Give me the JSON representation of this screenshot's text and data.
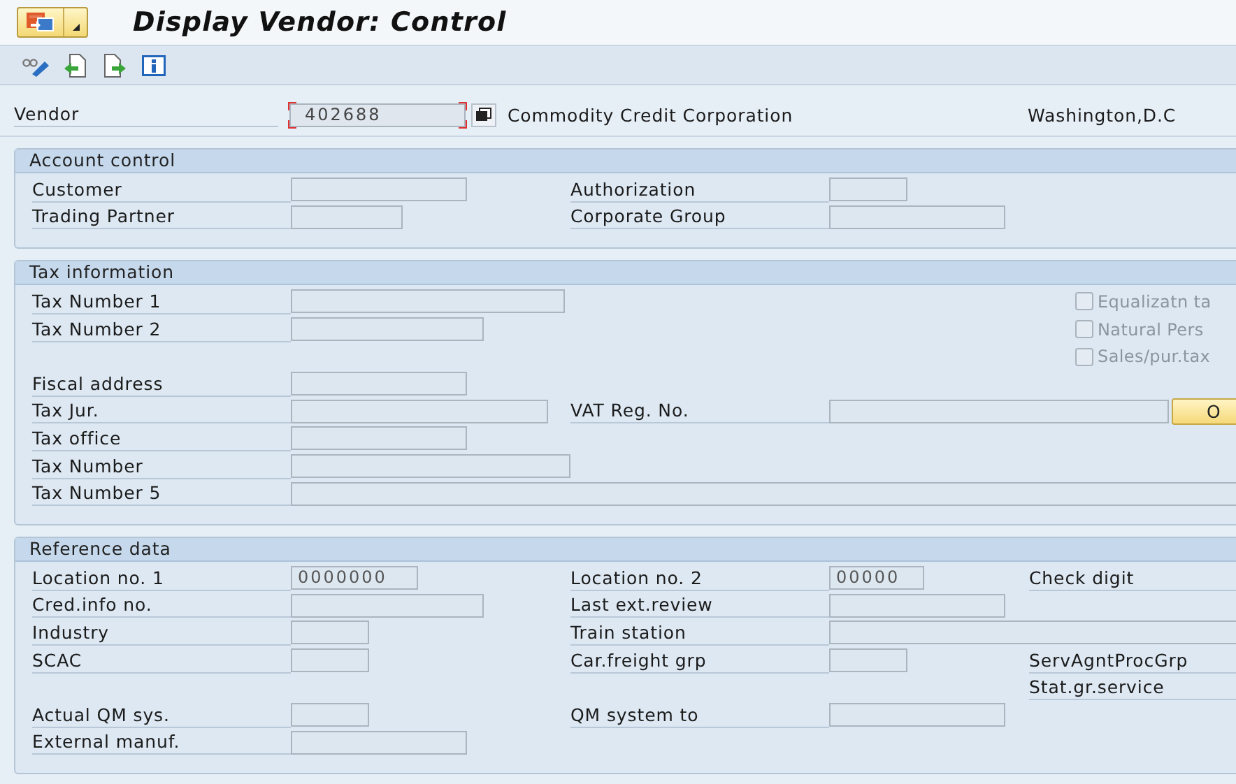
{
  "window": {
    "title": "Display Vendor: Control"
  },
  "vendor": {
    "label": "Vendor",
    "value": "402688",
    "name": "Commodity Credit Corporation",
    "city": "Washington,D.C"
  },
  "sections": [
    {
      "title": "Account control",
      "rows": [
        {
          "left": {
            "label": "Customer",
            "kind": "input"
          },
          "middle": {
            "label": "Authorization",
            "kind": "input"
          }
        },
        {
          "left": {
            "label": "Trading Partner",
            "kind": "input"
          },
          "middle": {
            "label": "Corporate Group",
            "kind": "input"
          }
        }
      ]
    },
    {
      "title": "Tax information",
      "rows": [
        {
          "left": {
            "label": "Tax Number 1",
            "kind": "input"
          },
          "right": {
            "label": "Equalizatn ta",
            "kind": "checkbox",
            "checked": false,
            "disabled": true
          }
        },
        {
          "left": {
            "label": "Tax Number 2",
            "kind": "input"
          },
          "right": {
            "label": "Natural Pers",
            "kind": "checkbox",
            "checked": false,
            "disabled": true
          }
        },
        {
          "right": {
            "label": "Sales/pur.tax",
            "kind": "checkbox",
            "checked": false,
            "disabled": true
          }
        },
        {
          "left": {
            "label": "Fiscal address",
            "kind": "input"
          }
        },
        {
          "left": {
            "label": "Tax Jur.",
            "kind": "input"
          },
          "middle": {
            "label": "VAT Reg. No.",
            "kind": "input",
            "button": "O"
          }
        },
        {
          "left": {
            "label": "Tax office",
            "kind": "input"
          }
        },
        {
          "left": {
            "label": "Tax Number",
            "kind": "input"
          }
        },
        {
          "left": {
            "label": "Tax Number 5",
            "kind": "input"
          }
        }
      ]
    },
    {
      "title": "Reference data",
      "rows": [
        {
          "left": {
            "label": "Location no. 1",
            "kind": "input",
            "value": "0000000"
          },
          "middle": {
            "label": "Location no. 2",
            "kind": "input",
            "value": "00000"
          },
          "right": {
            "label": "Check digit",
            "kind": "text"
          }
        },
        {
          "left": {
            "label": "Cred.info no.",
            "kind": "input"
          },
          "middle": {
            "label": "Last ext.review",
            "kind": "input"
          }
        },
        {
          "left": {
            "label": "Industry",
            "kind": "input"
          },
          "middle": {
            "label": "Train station",
            "kind": "input"
          }
        },
        {
          "left": {
            "label": "SCAC",
            "kind": "input"
          },
          "middle": {
            "label": "Car.freight grp",
            "kind": "input"
          },
          "right": {
            "label": "ServAgntProcGrp",
            "kind": "text"
          }
        },
        {
          "right": {
            "label": "Stat.gr.service",
            "kind": "text"
          }
        },
        {
          "left": {
            "label": "Actual QM sys.",
            "kind": "input"
          },
          "middle": {
            "label": "QM system to",
            "kind": "input"
          }
        },
        {
          "left": {
            "label": "External manuf.",
            "kind": "input"
          }
        }
      ]
    }
  ]
}
